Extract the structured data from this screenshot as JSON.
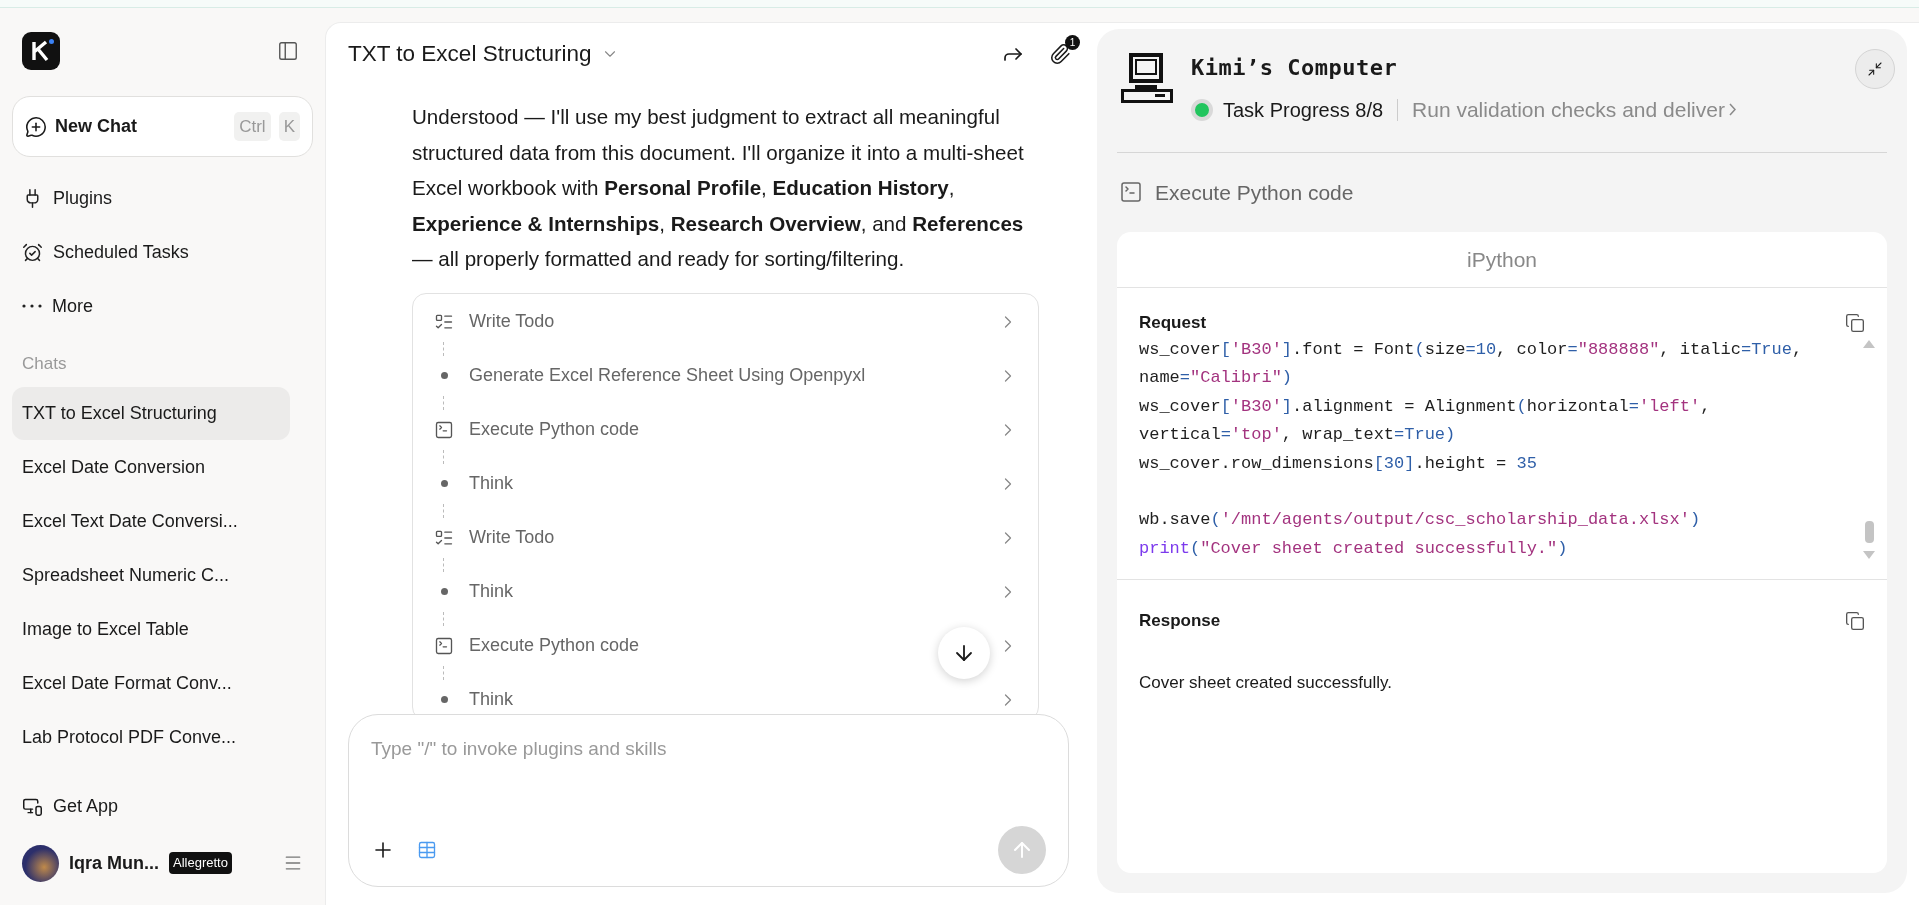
{
  "sidebar": {
    "new_chat": {
      "label": "New Chat",
      "shortcut": [
        "Ctrl",
        "K"
      ]
    },
    "nav": [
      {
        "kind": "plugins",
        "label": "Plugins"
      },
      {
        "kind": "scheduled",
        "label": "Scheduled Tasks"
      },
      {
        "kind": "more",
        "label": "More"
      }
    ],
    "chats_heading": "Chats",
    "chats": [
      {
        "title": "TXT to Excel Structuring",
        "selected": true
      },
      {
        "title": "Excel Date Conversion",
        "selected": false
      },
      {
        "title": "Excel Text Date Conversi...",
        "selected": false
      },
      {
        "title": "Spreadsheet Numeric C...",
        "selected": false
      },
      {
        "title": "Image to Excel Table",
        "selected": false
      },
      {
        "title": "Excel Date Format Conv...",
        "selected": false
      },
      {
        "title": "Lab Protocol PDF Conve...",
        "selected": false
      }
    ],
    "get_app": "Get App",
    "user": {
      "name": "Iqra Mun...",
      "plan": "Allegretto"
    }
  },
  "chat": {
    "title": "TXT to Excel Structuring",
    "attachments_count": "1",
    "message": "Understood — I'll use my best judgment to extract all meaningful structured data from this document. I'll organize it into a multi-sheet Excel workbook with **Personal Profile**, **Education History**, **Experience & Internships**, **Research Overview**, and **References** — all properly formatted and ready for sorting/filtering.",
    "steps": [
      {
        "kind": "todo",
        "label": "Write Todo"
      },
      {
        "kind": "bullet",
        "label": "Generate Excel Reference Sheet Using Openpyxl"
      },
      {
        "kind": "code",
        "label": "Execute Python code"
      },
      {
        "kind": "bullet",
        "label": "Think"
      },
      {
        "kind": "todo",
        "label": "Write Todo"
      },
      {
        "kind": "bullet",
        "label": "Think"
      },
      {
        "kind": "code",
        "label": "Execute Python code"
      },
      {
        "kind": "bullet",
        "label": "Think"
      }
    ],
    "input": {
      "placeholder": "Type \"/\" to invoke plugins and skills"
    }
  },
  "computer": {
    "title": "Kimi’s Computer",
    "progress": "Task Progress 8/8",
    "current_task": "Run validation checks and deliver",
    "tool": "Execute Python code",
    "panel_title": "iPython",
    "request_label": "Request",
    "code": [
      {
        "kind": "code",
        "tokens": [
          {
            "kind": "name",
            "text": "ws_cover"
          },
          {
            "kind": "punct",
            "text": "["
          },
          {
            "kind": "string",
            "text": "'B30'"
          },
          {
            "kind": "punct",
            "text": "]"
          },
          {
            "kind": "name",
            "text": ".font = Font"
          },
          {
            "kind": "punct",
            "text": "("
          },
          {
            "kind": "name",
            "text": "size"
          },
          {
            "kind": "punct",
            "text": "="
          },
          {
            "kind": "number",
            "text": "10"
          },
          {
            "kind": "name",
            "text": ", color"
          },
          {
            "kind": "punct",
            "text": "="
          },
          {
            "kind": "string",
            "text": "\"888888\""
          },
          {
            "kind": "name",
            "text": ", italic"
          },
          {
            "kind": "punct",
            "text": "="
          },
          {
            "kind": "number",
            "text": "True"
          },
          {
            "kind": "name",
            "text": ","
          }
        ]
      },
      {
        "kind": "code",
        "tokens": [
          {
            "kind": "name",
            "text": "name"
          },
          {
            "kind": "punct",
            "text": "="
          },
          {
            "kind": "string",
            "text": "\"Calibri\""
          },
          {
            "kind": "punct",
            "text": ")"
          }
        ]
      },
      {
        "kind": "code",
        "tokens": [
          {
            "kind": "name",
            "text": "ws_cover"
          },
          {
            "kind": "punct",
            "text": "["
          },
          {
            "kind": "string",
            "text": "'B30'"
          },
          {
            "kind": "punct",
            "text": "]"
          },
          {
            "kind": "name",
            "text": ".alignment = Alignment"
          },
          {
            "kind": "punct",
            "text": "("
          },
          {
            "kind": "name",
            "text": "horizontal"
          },
          {
            "kind": "punct",
            "text": "="
          },
          {
            "kind": "string",
            "text": "'left'"
          },
          {
            "kind": "name",
            "text": ","
          }
        ]
      },
      {
        "kind": "code",
        "tokens": [
          {
            "kind": "name",
            "text": "vertical"
          },
          {
            "kind": "punct",
            "text": "="
          },
          {
            "kind": "string",
            "text": "'top'"
          },
          {
            "kind": "name",
            "text": ", wrap_text"
          },
          {
            "kind": "punct",
            "text": "="
          },
          {
            "kind": "number",
            "text": "True"
          },
          {
            "kind": "punct",
            "text": ")"
          }
        ]
      },
      {
        "kind": "code",
        "tokens": [
          {
            "kind": "name",
            "text": "ws_cover.row_dimensions"
          },
          {
            "kind": "punct",
            "text": "["
          },
          {
            "kind": "number",
            "text": "30"
          },
          {
            "kind": "punct",
            "text": "]"
          },
          {
            "kind": "name",
            "text": ".height = "
          },
          {
            "kind": "number",
            "text": "35"
          }
        ]
      },
      {
        "kind": "blank"
      },
      {
        "kind": "code",
        "tokens": [
          {
            "kind": "name",
            "text": "wb.save"
          },
          {
            "kind": "punct",
            "text": "("
          },
          {
            "kind": "string",
            "text": "'/mnt/agents/output/csc_scholarship_data.xlsx'"
          },
          {
            "kind": "punct",
            "text": ")"
          }
        ]
      },
      {
        "kind": "code",
        "tokens": [
          {
            "kind": "builtin",
            "text": "print"
          },
          {
            "kind": "punct",
            "text": "("
          },
          {
            "kind": "string",
            "text": "\"Cover sheet created successfully.\""
          },
          {
            "kind": "punct",
            "text": ")"
          }
        ]
      }
    ],
    "response_label": "Response",
    "response": "Cover sheet created successfully."
  }
}
